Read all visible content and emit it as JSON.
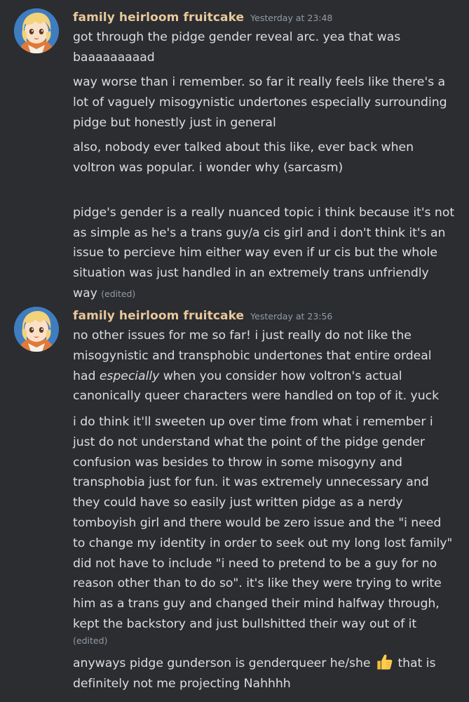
{
  "groups": [
    {
      "username": "family heirloom fruitcake",
      "timestamp": "Yesterday at 23:48",
      "messages": [
        {
          "text": "got through the pidge gender reveal arc. yea that was\nbaaaaaaaaad",
          "edited": ""
        },
        {
          "text": "way worse than i remember. so far it really feels like there's a\nlot of vaguely misogynistic undertones especially surrounding\npidge but honestly just in general",
          "edited": ""
        },
        {
          "text": "also, nobody ever talked about this like, ever back when\nvoltron was popular. i wonder why (sarcasm)",
          "edited": ""
        },
        {
          "text": "pidge's gender is a really nuanced topic i think because it's not\nas simple as he's a trans guy/a cis girl and i don't think it's an\nissue to percieve him either way even if ur cis but the whole\nsituation was just handled in an extremely trans unfriendly\nway",
          "edited": "(edited)"
        }
      ]
    },
    {
      "username": "family heirloom fruitcake",
      "timestamp": "Yesterday at 23:56",
      "messages": [
        {
          "text_before": "no other issues for me so far! i just really do not like the\nmisogynistic and transphobic undertones that entire ordeal\nhad ",
          "text_emphasis": "especially",
          "text_after": " when you consider how voltron's actual\ncanonically queer characters were handled on top of it. yuck",
          "edited": ""
        },
        {
          "text": "i do think it'll sweeten up over time from what i remember i\njust do not understand what the point of the pidge gender\nconfusion was besides to throw in some misogyny and\ntransphobia just for fun. it was extremely unnecessary and\nthey could have so easily just written pidge as a nerdy\ntomboyish girl and there would be zero issue and the \"i need\nto change my identity in order to seek out my long lost family\"\ndid not have to include \"i need to pretend to be a guy for no\nreason other than to do so\". it's like they were trying to write\nhim as a trans guy and changed their mind halfway through,\nkept the backstory and just bullshitted their way out of it",
          "edited": "(edited)"
        },
        {
          "text_before": "anyways pidge gunderson is genderqueer he/she",
          "emoji": "thumbs-up",
          "text_after": " that is\ndefinitely not me projecting Nahhhh",
          "edited": ""
        }
      ]
    }
  ],
  "colors": {
    "background": "#2b2d31",
    "username": "#e9c89a",
    "text": "#dbdee1",
    "muted": "#949ba4"
  }
}
